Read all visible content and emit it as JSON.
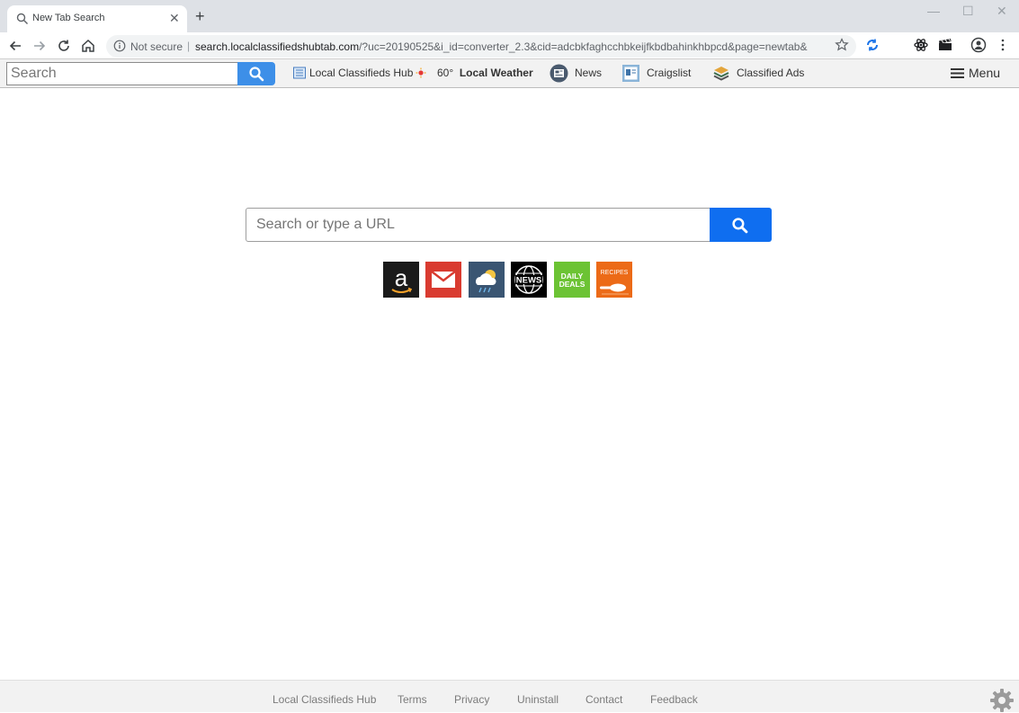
{
  "browser": {
    "tab_title": "New Tab Search",
    "tab_close": "✕",
    "new_tab": "+",
    "window_controls": {
      "minimize": "—",
      "maximize": "☐",
      "close": "✕"
    },
    "omnibox": {
      "security_label": "Not secure",
      "separator": "|",
      "url_host": "search.localclassifiedshubtab.com",
      "url_path": "/?uc=20190525&i_id=converter_2.3&cid=adcbkfaghcchbkeijfkbdbahinkhbpcd&page=newtab&"
    }
  },
  "ext_toolbar": {
    "search_placeholder": "Search",
    "links": {
      "hub": "Local Classifieds Hub",
      "weather_temp": "60°",
      "weather_label": "Local Weather",
      "news": "News",
      "craigslist": "Craigslist",
      "classified_ads": "Classified Ads"
    },
    "menu_label": "Menu",
    "accent": "#3d8fe8"
  },
  "main": {
    "search_placeholder": "Search or type a URL",
    "search_button_color": "#0f6ef0",
    "tiles": [
      {
        "name": "amazon",
        "label": "a",
        "color": "#1a1a1a"
      },
      {
        "name": "gmail",
        "label": "",
        "color": "#d93b30"
      },
      {
        "name": "weather",
        "label": "",
        "color": "#3a5572"
      },
      {
        "name": "news",
        "label": "NEWS",
        "color": "#000000"
      },
      {
        "name": "daily-deals",
        "label": "DAILY DEALS",
        "color": "#6cc334"
      },
      {
        "name": "recipes",
        "label": "RECIPES",
        "color": "#ec6a17"
      }
    ]
  },
  "footer": {
    "links": [
      "Local Classifieds Hub",
      "Terms",
      "Privacy",
      "Uninstall",
      "Contact",
      "Feedback"
    ]
  }
}
